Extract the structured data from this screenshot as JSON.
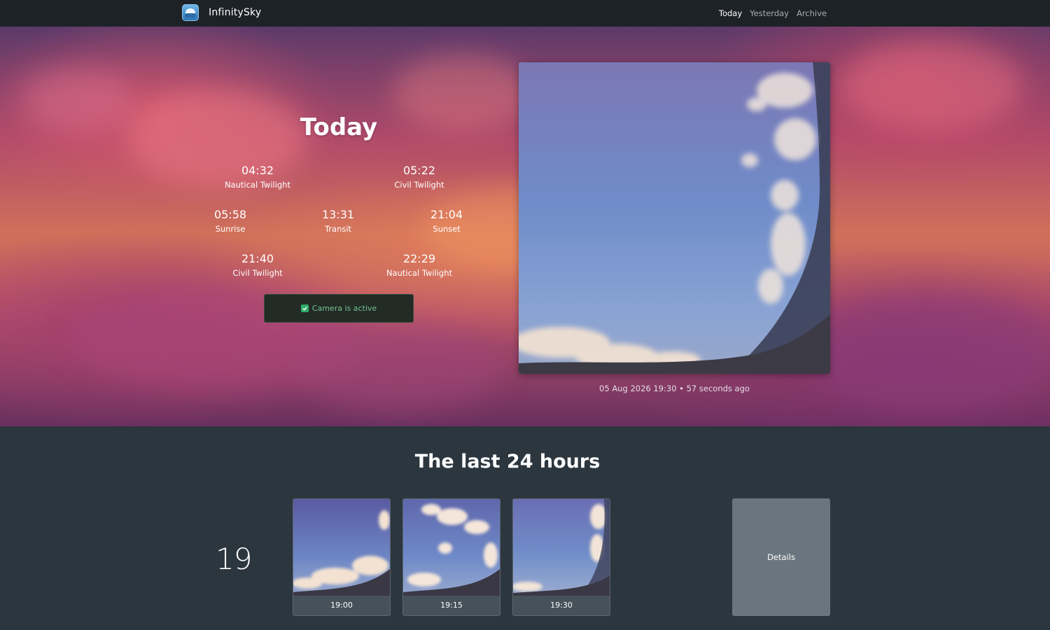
{
  "nav": {
    "brand": "InfinitySky",
    "links": [
      {
        "label": "Today",
        "active": true
      },
      {
        "label": "Yesterday",
        "active": false
      },
      {
        "label": "Archive",
        "active": false
      }
    ]
  },
  "hero": {
    "title": "Today",
    "times": [
      {
        "time": "04:32",
        "label": "Nautical Twilight"
      },
      {
        "time": "05:22",
        "label": "Civil Twilight"
      },
      {
        "time": "05:58",
        "label": "Sunrise"
      },
      {
        "time": "13:31",
        "label": "Transit"
      },
      {
        "time": "21:04",
        "label": "Sunset"
      },
      {
        "time": "21:40",
        "label": "Civil Twilight"
      },
      {
        "time": "22:29",
        "label": "Nautical Twilight"
      }
    ],
    "camera_status": "Camera is active",
    "image_caption": "05 Aug 2026 19:30 • 57 seconds ago"
  },
  "last24": {
    "title": "The last 24 hours",
    "hour": "19",
    "thumbnails": [
      {
        "time": "19:00"
      },
      {
        "time": "19:15"
      },
      {
        "time": "19:30"
      }
    ],
    "details_label": "Details"
  },
  "colors": {
    "navbar_bg": "#1d2227",
    "page_bg": "#2c363f",
    "status_green": "#2fae6a",
    "details_bg": "#69767f"
  }
}
